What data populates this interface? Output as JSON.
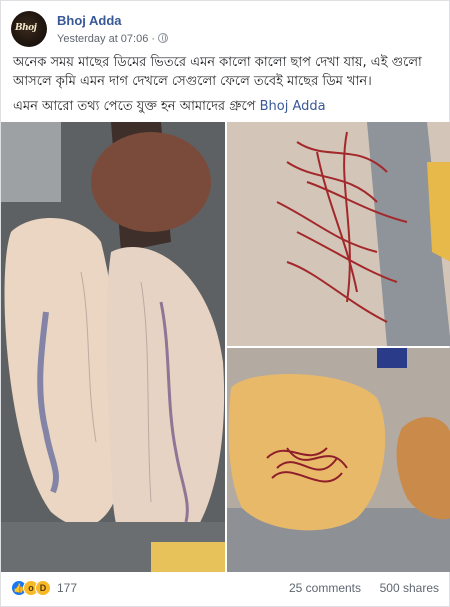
{
  "post": {
    "page_name": "Bhoj Adda",
    "avatar_text": "Bhoj",
    "timestamp": "Yesterday at 07:06",
    "dot": "·",
    "body_line1": "অনেক সময় মাছের ডিমের ভিতরে এমন কালো কালো ছাপ দেখা যায়, এই গুলো আসলে কৃমি এমন দাগ দেখলে সেগুলো ফেলে তবেই মাছের ডিম খান।",
    "body_line2_prefix": "এমন আরো তথ্য পেতে যুক্ত হন আমাদের গ্রুপে ",
    "group_link": "Bhoj Adda"
  },
  "photos": [
    {
      "name": "fish-roe-photo",
      "colors": {
        "egg": "#ecd9c6",
        "vein": "#6a6fa0",
        "bg": "#5e6163"
      }
    },
    {
      "name": "red-worms-on-steel-photo",
      "colors": {
        "worm": "#a3282b",
        "bg": "#d3c6b8",
        "steel": "#8e949a"
      }
    },
    {
      "name": "roe-with-worms-photo",
      "colors": {
        "roe": "#e9b96a",
        "worm": "#8e1f2a",
        "bg": "#b3aaa2"
      }
    }
  ],
  "footer": {
    "reaction_count": "177",
    "comments": "25 comments",
    "shares": "500 shares",
    "reaction_icons": [
      "like-icon",
      "wow-icon",
      "haha-icon"
    ]
  }
}
